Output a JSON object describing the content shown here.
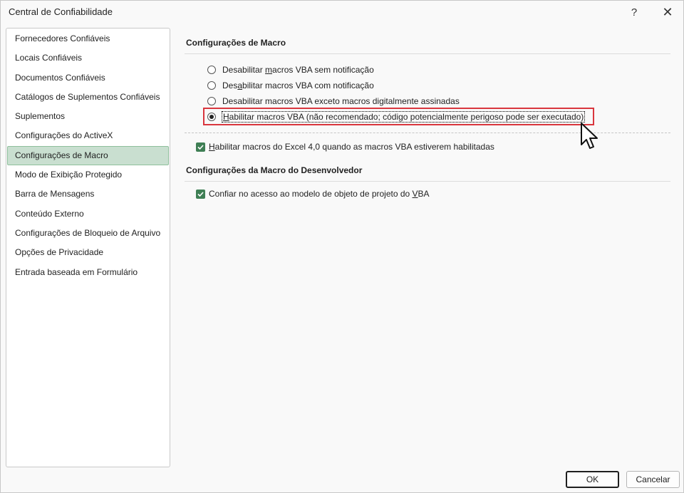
{
  "window": {
    "title": "Central de Confiabilidade",
    "help_icon": "?",
    "close_icon": "✕"
  },
  "sidebar": {
    "items": [
      {
        "label": "Fornecedores Confiáveis",
        "selected": false
      },
      {
        "label": "Locais Confiáveis",
        "selected": false
      },
      {
        "label": "Documentos Confiáveis",
        "selected": false
      },
      {
        "label": "Catálogos de Suplementos Confiáveis",
        "selected": false
      },
      {
        "label": "Suplementos",
        "selected": false
      },
      {
        "label": "Configurações do ActiveX",
        "selected": false
      },
      {
        "label": "Configurações de Macro",
        "selected": true
      },
      {
        "label": "Modo de Exibição Protegido",
        "selected": false
      },
      {
        "label": "Barra de Mensagens",
        "selected": false
      },
      {
        "label": "Conteúdo Externo",
        "selected": false
      },
      {
        "label": "Configurações de Bloqueio de Arquivo",
        "selected": false
      },
      {
        "label": "Opções de Privacidade",
        "selected": false
      },
      {
        "label": "Entrada baseada em Formulário",
        "selected": false
      }
    ]
  },
  "macro_settings": {
    "title": "Configurações de Macro",
    "options": [
      {
        "pre": "Desabilitar ",
        "acc": "m",
        "post": "acros VBA sem notificação",
        "checked": false
      },
      {
        "pre": "Des",
        "acc": "a",
        "post": "bilitar macros VBA com notificação",
        "checked": false
      },
      {
        "pre": "Desabilitar macros VBA exceto macros digitalmente assinadas",
        "acc": "",
        "post": "",
        "checked": false
      },
      {
        "pre": "",
        "acc": "H",
        "post": "abilitar macros VBA (não recomendado; código potencialmente perigoso pode ser executado)",
        "checked": true
      }
    ],
    "excel4_checkbox": {
      "acc": "H",
      "post": "abilitar macros do Excel 4,0 quando as macros VBA estiverem habilitadas",
      "checked": true
    }
  },
  "developer_settings": {
    "title": "Configurações da Macro do Desenvolvedor",
    "vba_checkbox": {
      "pre": "Confiar no acesso ao modelo de objeto de projeto do ",
      "acc": "V",
      "post": "BA",
      "checked": true
    }
  },
  "footer": {
    "ok_label": "OK",
    "cancel_label": "Cancelar"
  },
  "colors": {
    "selected_item": "#c9dfd0",
    "checkbox": "#3f7f55",
    "highlight": "#d9363e"
  }
}
